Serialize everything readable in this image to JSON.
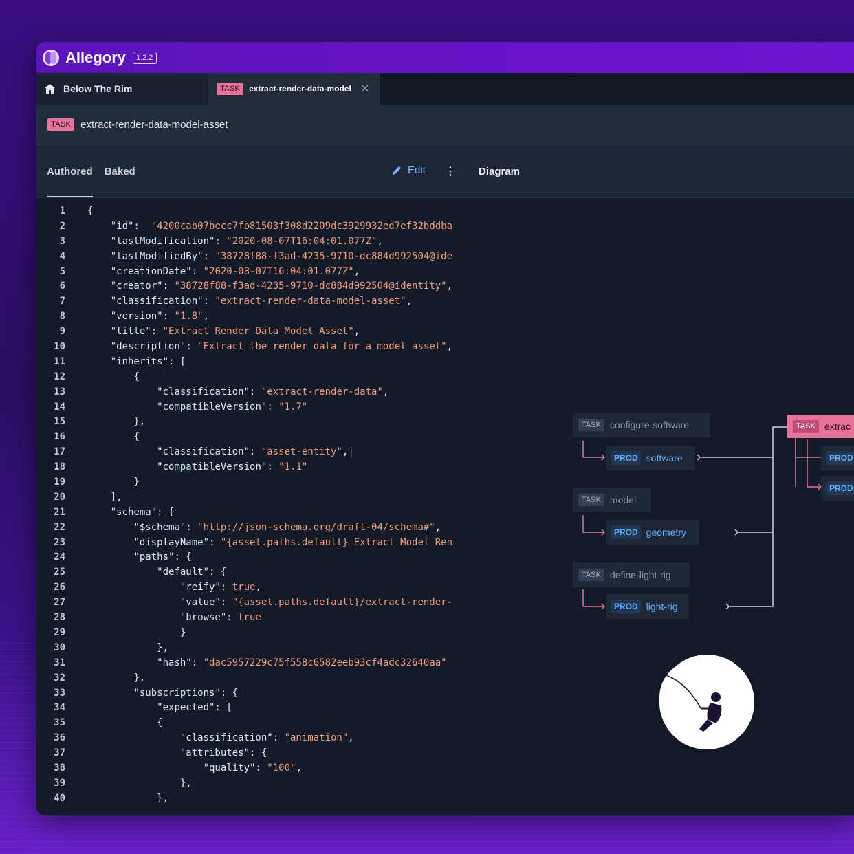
{
  "app": {
    "name": "Allegory",
    "version": "1.2.2"
  },
  "tabs": {
    "home_label": "Below The Rim",
    "task_badge": "TASK",
    "task_label": "extract-render-data-model",
    "close_glyph": "✕"
  },
  "subheader": {
    "badge": "TASK",
    "title": "extract-render-data-model-asset"
  },
  "left_pane": {
    "tabs": [
      "Authored",
      "Baked"
    ],
    "edit_label": "Edit",
    "more_glyph": "⋮"
  },
  "code_lines": [
    {
      "n": "1",
      "t": "{"
    },
    {
      "n": "2",
      "t": "    \"id\":  \"4200cab07becc7fb81503f308d2209dc3929932ed7ef32bddba"
    },
    {
      "n": "3",
      "t": "    \"lastModification\": \"2020-08-07T16:04:01.077Z\","
    },
    {
      "n": "4",
      "t": "    \"lastModifiedBy\": \"38728f88-f3ad-4235-9710-dc884d992504@ide"
    },
    {
      "n": "5",
      "t": "    \"creationDate\": \"2020-08-07T16:04:01.077Z\","
    },
    {
      "n": "6",
      "t": "    \"creator\": \"38728f88-f3ad-4235-9710-dc884d992504@identity\","
    },
    {
      "n": "7",
      "t": "    \"classification\": \"extract-render-data-model-asset\","
    },
    {
      "n": "8",
      "t": "    \"version\": \"1.8\","
    },
    {
      "n": "9",
      "t": "    \"title\": \"Extract Render Data Model Asset\","
    },
    {
      "n": "10",
      "t": "    \"description\": \"Extract the render data for a model asset\","
    },
    {
      "n": "11",
      "t": "    \"inherits\": ["
    },
    {
      "n": "12",
      "t": "        {"
    },
    {
      "n": "13",
      "t": "            \"classification\": \"extract-render-data\","
    },
    {
      "n": "14",
      "t": "            \"compatibleVersion\": \"1.7\""
    },
    {
      "n": "15",
      "t": "        },"
    },
    {
      "n": "16",
      "t": "        {"
    },
    {
      "n": "17",
      "t": "            \"classification\": \"asset-entity\",|"
    },
    {
      "n": "18",
      "t": "            \"compatibleVersion\": \"1.1\""
    },
    {
      "n": "19",
      "t": "        }"
    },
    {
      "n": "20",
      "t": "    ],"
    },
    {
      "n": "21",
      "t": "    \"schema\": {"
    },
    {
      "n": "22",
      "t": "        \"$schema\": \"http://json-schema.org/draft-04/schema#\","
    },
    {
      "n": "23",
      "t": "        \"displayName\": \"{asset.paths.default} Extract Model Ren"
    },
    {
      "n": "24",
      "t": "        \"paths\": {"
    },
    {
      "n": "25",
      "t": "            \"default\": {"
    },
    {
      "n": "26",
      "t": "                \"reify\": true,"
    },
    {
      "n": "27",
      "t": "                \"value\": \"{asset.paths.default}/extract-render-"
    },
    {
      "n": "28",
      "t": "                \"browse\": true"
    },
    {
      "n": "29",
      "t": "                }"
    },
    {
      "n": "30",
      "t": "            },"
    },
    {
      "n": "31",
      "t": "            \"hash\": \"dac5957229c75f558c6582eeb93cf4adc32640aa\""
    },
    {
      "n": "32",
      "t": "        },"
    },
    {
      "n": "33",
      "t": "        \"subscriptions\": {"
    },
    {
      "n": "34",
      "t": "            \"expected\": ["
    },
    {
      "n": "35",
      "t": "            {"
    },
    {
      "n": "36",
      "t": "                \"classification\": \"animation\","
    },
    {
      "n": "37",
      "t": "                \"attributes\": {"
    },
    {
      "n": "38",
      "t": "                    \"quality\": \"100\","
    },
    {
      "n": "39",
      "t": "                },"
    },
    {
      "n": "40",
      "t": "            },"
    }
  ],
  "diagram": {
    "title": "Diagram",
    "tasks": [
      {
        "badge": "TASK",
        "label": "configure-software",
        "prod_badge": "PROD",
        "prod_label": "software"
      },
      {
        "badge": "TASK",
        "label": "model",
        "prod_badge": "PROD",
        "prod_label": "geometry"
      },
      {
        "badge": "TASK",
        "label": "define-light-rig",
        "prod_badge": "PROD",
        "prod_label": "light-rig"
      }
    ],
    "active": {
      "badge": "TASK",
      "label": "extrac",
      "prod_badges": [
        "PROD",
        "PROD"
      ]
    }
  },
  "colors": {
    "accent": "#6a13c9",
    "task_pink": "#e8739a",
    "prod_blue": "#5fb3ff",
    "string": "#f09a7c"
  }
}
